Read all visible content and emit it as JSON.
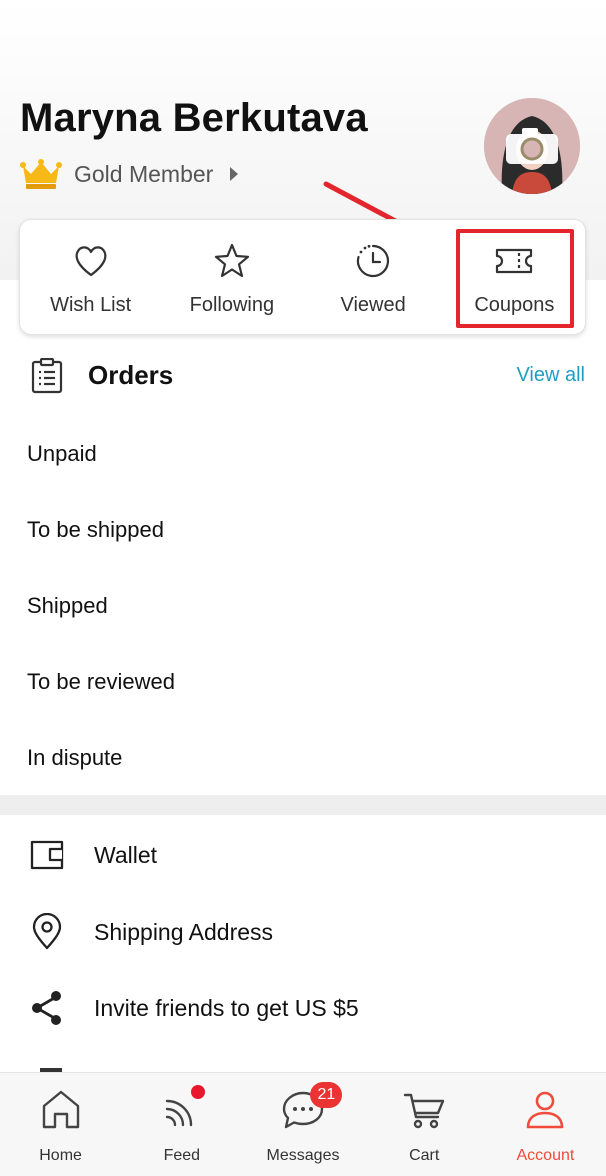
{
  "profile": {
    "name": "Maryna Berkutava",
    "membership": "Gold Member"
  },
  "quick_actions": [
    {
      "label": "Wish List",
      "icon": "heart-icon"
    },
    {
      "label": "Following",
      "icon": "star-icon"
    },
    {
      "label": "Viewed",
      "icon": "history-clock-icon"
    },
    {
      "label": "Coupons",
      "icon": "ticket-icon"
    }
  ],
  "annotation": {
    "highlight_color": "#e3262d",
    "target": "Coupons"
  },
  "orders": {
    "title": "Orders",
    "view_all": "View all",
    "statuses": [
      "Unpaid",
      "To be shipped",
      "Shipped",
      "To be reviewed",
      "In dispute"
    ]
  },
  "menu": [
    {
      "label": "Wallet",
      "icon": "wallet-icon"
    },
    {
      "label": "Shipping Address",
      "icon": "location-pin-icon"
    },
    {
      "label": "Invite friends to get US $5",
      "icon": "share-icon"
    }
  ],
  "tabs": [
    {
      "label": "Home",
      "icon": "home-icon"
    },
    {
      "label": "Feed",
      "icon": "feed-icon",
      "dot": true
    },
    {
      "label": "Messages",
      "icon": "chat-icon",
      "badge": "21"
    },
    {
      "label": "Cart",
      "icon": "cart-icon"
    },
    {
      "label": "Account",
      "icon": "account-icon",
      "active": true
    }
  ],
  "colors": {
    "accent": "#f04b3c",
    "link": "#1f9ec2",
    "badge": "#ec3333"
  }
}
